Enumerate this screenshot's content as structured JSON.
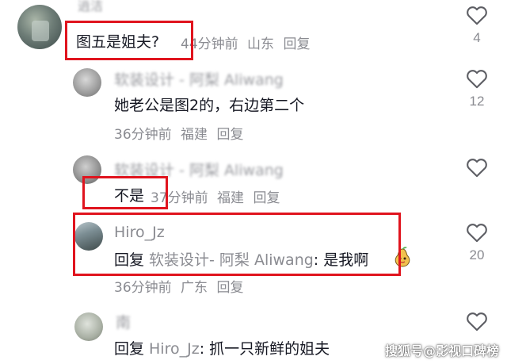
{
  "comments": [
    {
      "username": "逍洁",
      "text": "图五是姐夫?",
      "time": "44分钟前",
      "location": "山东",
      "reply_label": "回复",
      "likes": "4"
    },
    {
      "username": "软装设计 - 阿梨 Aliwang",
      "text": "她老公是图2的，右边第二个",
      "time": "36分钟前",
      "location": "福建",
      "reply_label": "回复",
      "likes": "12"
    },
    {
      "username": "软装设计 - 阿梨 Aliwang",
      "text": "不是",
      "time": "37分钟前",
      "location": "福建",
      "reply_label": "回复",
      "likes": ""
    },
    {
      "username": "Hiro_Jz",
      "reply_prefix": "回复",
      "reply_target": "软装设计- 阿梨 Aliwang",
      "text": ": 是我啊",
      "time": "36分钟前",
      "location": "广东",
      "reply_label": "回复",
      "likes": "20"
    },
    {
      "username": "南",
      "reply_prefix": "回复",
      "reply_target": "Hiro_Jz",
      "text": ": 抓一只新鲜的姐夫",
      "likes": ""
    }
  ],
  "icons": {
    "like": "heart-outline-icon",
    "sticker": "pear-sticker-icon"
  },
  "highlight_color": "#e0141e",
  "watermark": "搜狐号@影视口碑榜"
}
